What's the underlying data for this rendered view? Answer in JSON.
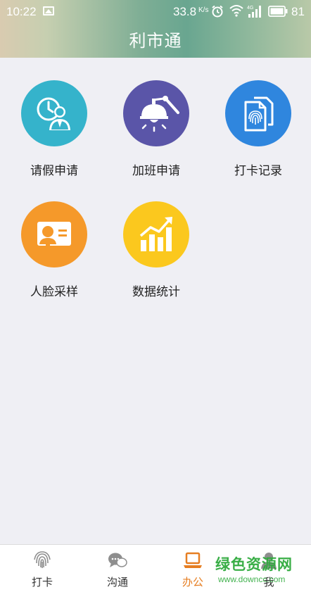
{
  "status_bar": {
    "time": "10:22",
    "net_speed": "33.8",
    "net_speed_unit": "K/s",
    "battery": "81"
  },
  "header": {
    "title": "利市通"
  },
  "tiles": [
    {
      "label": "请假申请",
      "icon": "leave-clock-person-icon",
      "color": "#35b3cb"
    },
    {
      "label": "加班申请",
      "icon": "desk-lamp-icon",
      "color": "#5a55a8"
    },
    {
      "label": "打卡记录",
      "icon": "fingerprint-document-icon",
      "color": "#2f86de"
    },
    {
      "label": "人脸采样",
      "icon": "id-card-icon",
      "color": "#f5992a"
    },
    {
      "label": "数据统计",
      "icon": "bar-chart-trend-icon",
      "color": "#fbc81e"
    }
  ],
  "bottom_nav": {
    "items": [
      {
        "label": "打卡",
        "icon": "fingerprint-icon"
      },
      {
        "label": "沟通",
        "icon": "chat-bubbles-icon"
      },
      {
        "label": "办公",
        "icon": "laptop-icon",
        "active": true
      },
      {
        "label": "我",
        "icon": "user-icon"
      }
    ],
    "active_color": "#e67e22"
  },
  "watermark": {
    "main": "绿色资源网",
    "sub": "www.downcc.com"
  }
}
